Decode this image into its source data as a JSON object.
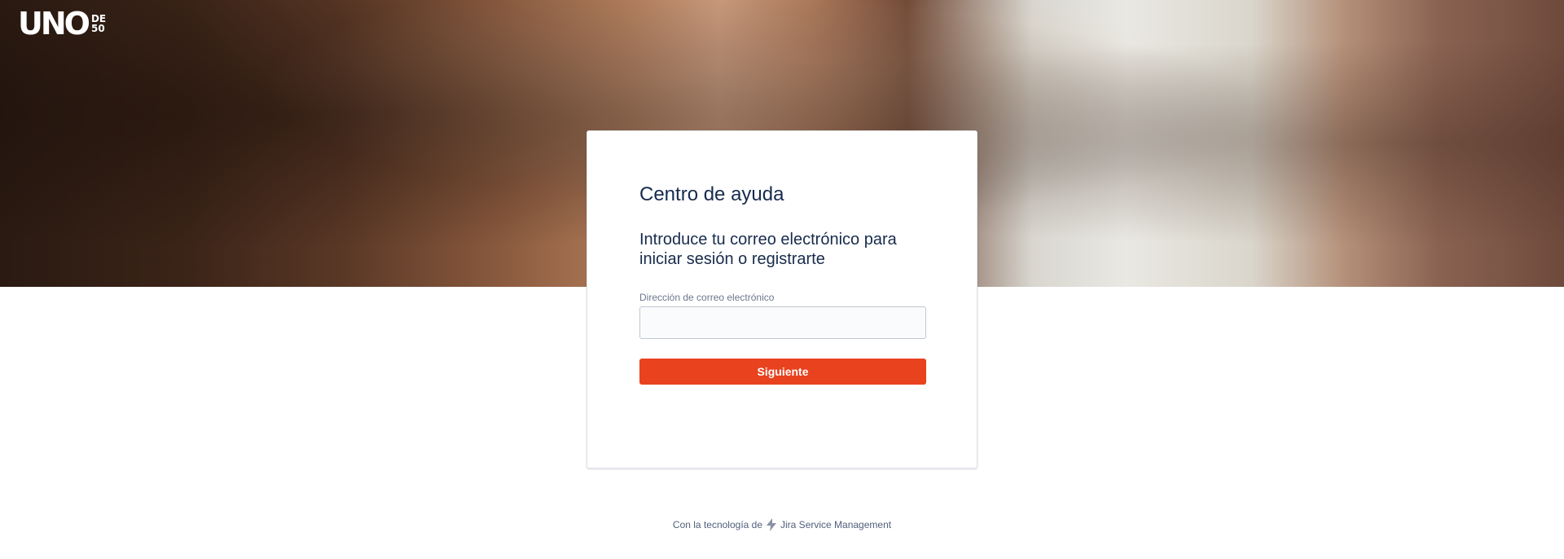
{
  "brand": {
    "logo_main": "UNO",
    "logo_sub_top": "DE",
    "logo_sub_bottom": "50"
  },
  "card": {
    "title": "Centro de ayuda",
    "subtitle": "Introduce tu correo electrónico para iniciar sesión o registrarte",
    "email_label": "Dirección de correo electrónico",
    "email_value": "",
    "next_label": "Siguiente"
  },
  "footer": {
    "prefix": "Con la tecnología de",
    "product": "Jira Service Management",
    "icon": "bolt-icon"
  },
  "colors": {
    "accent": "#e8421f",
    "text": "#172b4d",
    "muted": "#6b778c"
  }
}
